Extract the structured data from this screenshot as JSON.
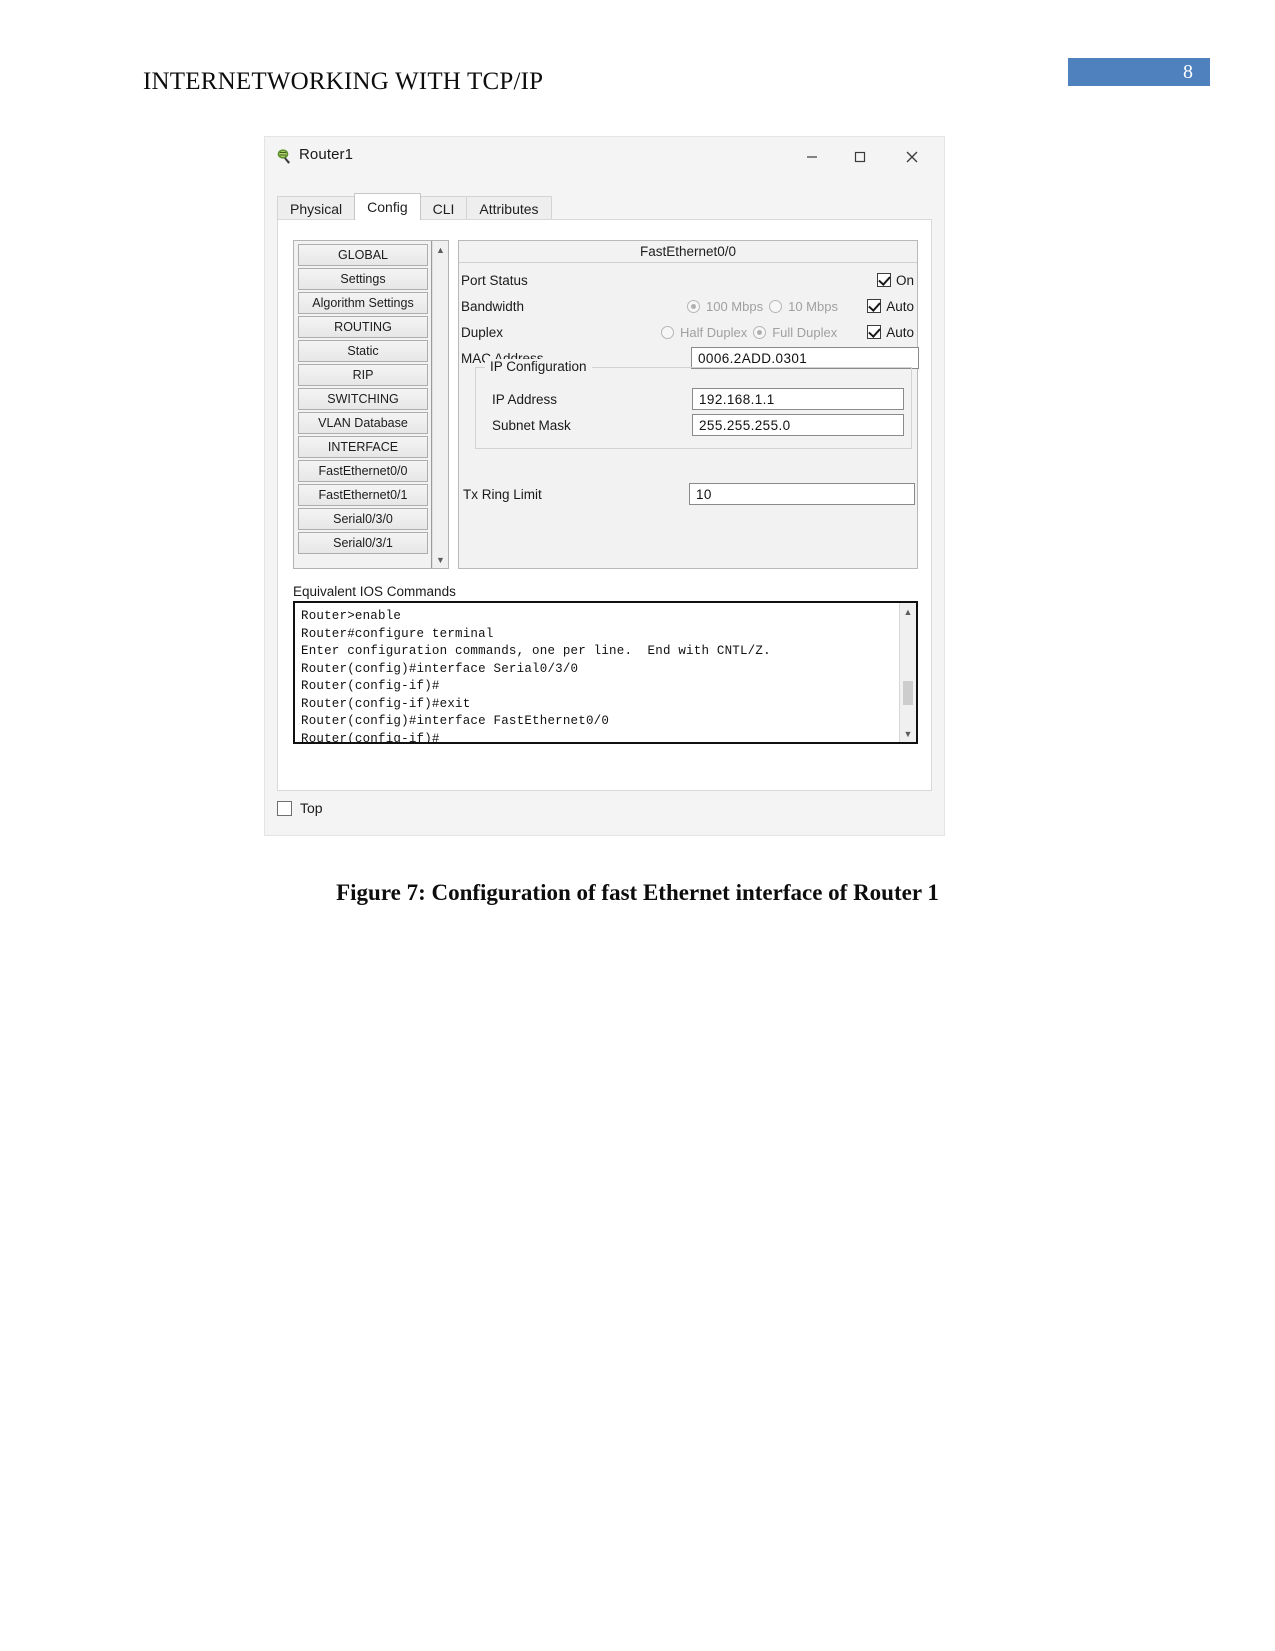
{
  "document": {
    "header_title": "INTERNETWORKING WITH TCP/IP",
    "page_number": "8",
    "page_badge_color": "#4e81bd",
    "caption": "Figure 7: Configuration of fast Ethernet interface of Router 1"
  },
  "window": {
    "title": "Router1",
    "icon": "router-icon",
    "minimize_label": "—",
    "maximize_label": "□",
    "close_label": "✕"
  },
  "tabs": [
    {
      "label": "Physical",
      "active": false
    },
    {
      "label": "Config",
      "active": true
    },
    {
      "label": "CLI",
      "active": false
    },
    {
      "label": "Attributes",
      "active": false
    }
  ],
  "sidebar": {
    "items": [
      {
        "label": "GLOBAL"
      },
      {
        "label": "Settings"
      },
      {
        "label": "Algorithm Settings"
      },
      {
        "label": "ROUTING"
      },
      {
        "label": "Static"
      },
      {
        "label": "RIP"
      },
      {
        "label": "SWITCHING"
      },
      {
        "label": "VLAN Database"
      },
      {
        "label": "INTERFACE"
      },
      {
        "label": "FastEthernet0/0"
      },
      {
        "label": "FastEthernet0/1"
      },
      {
        "label": "Serial0/3/0"
      },
      {
        "label": "Serial0/3/1"
      }
    ],
    "scroll_up": "▲",
    "scroll_down": "▼"
  },
  "config": {
    "panel_title": "FastEthernet0/0",
    "port_status": {
      "label": "Port Status",
      "checkbox_label": "On",
      "checked": true
    },
    "bandwidth": {
      "label": "Bandwidth",
      "option_100": "100 Mbps",
      "option_10": "10 Mbps",
      "selected": "100 Mbps",
      "checkbox_label": "Auto",
      "checked": true
    },
    "duplex": {
      "label": "Duplex",
      "option_half": "Half Duplex",
      "option_full": "Full Duplex",
      "selected": "Full Duplex",
      "checkbox_label": "Auto",
      "checked": true
    },
    "mac_address": {
      "label": "MAC Address",
      "value": "0006.2ADD.0301"
    },
    "ip_configuration": {
      "group_label": "IP Configuration",
      "ip_address": {
        "label": "IP Address",
        "value": "192.168.1.1"
      },
      "subnet_mask": {
        "label": "Subnet Mask",
        "value": "255.255.255.0"
      }
    },
    "tx_ring_limit": {
      "label": "Tx Ring Limit",
      "value": "10"
    }
  },
  "ios": {
    "label": "Equivalent IOS Commands",
    "lines": "Router>enable\nRouter#configure terminal\nEnter configuration commands, one per line.  End with CNTL/Z.\nRouter(config)#interface Serial0/3/0\nRouter(config-if)#\nRouter(config-if)#exit\nRouter(config)#interface FastEthernet0/0\nRouter(config-if)#",
    "scroll_up": "▲",
    "scroll_down": "▼"
  },
  "bottom": {
    "top_checkbox_label": "Top",
    "checked": false
  }
}
